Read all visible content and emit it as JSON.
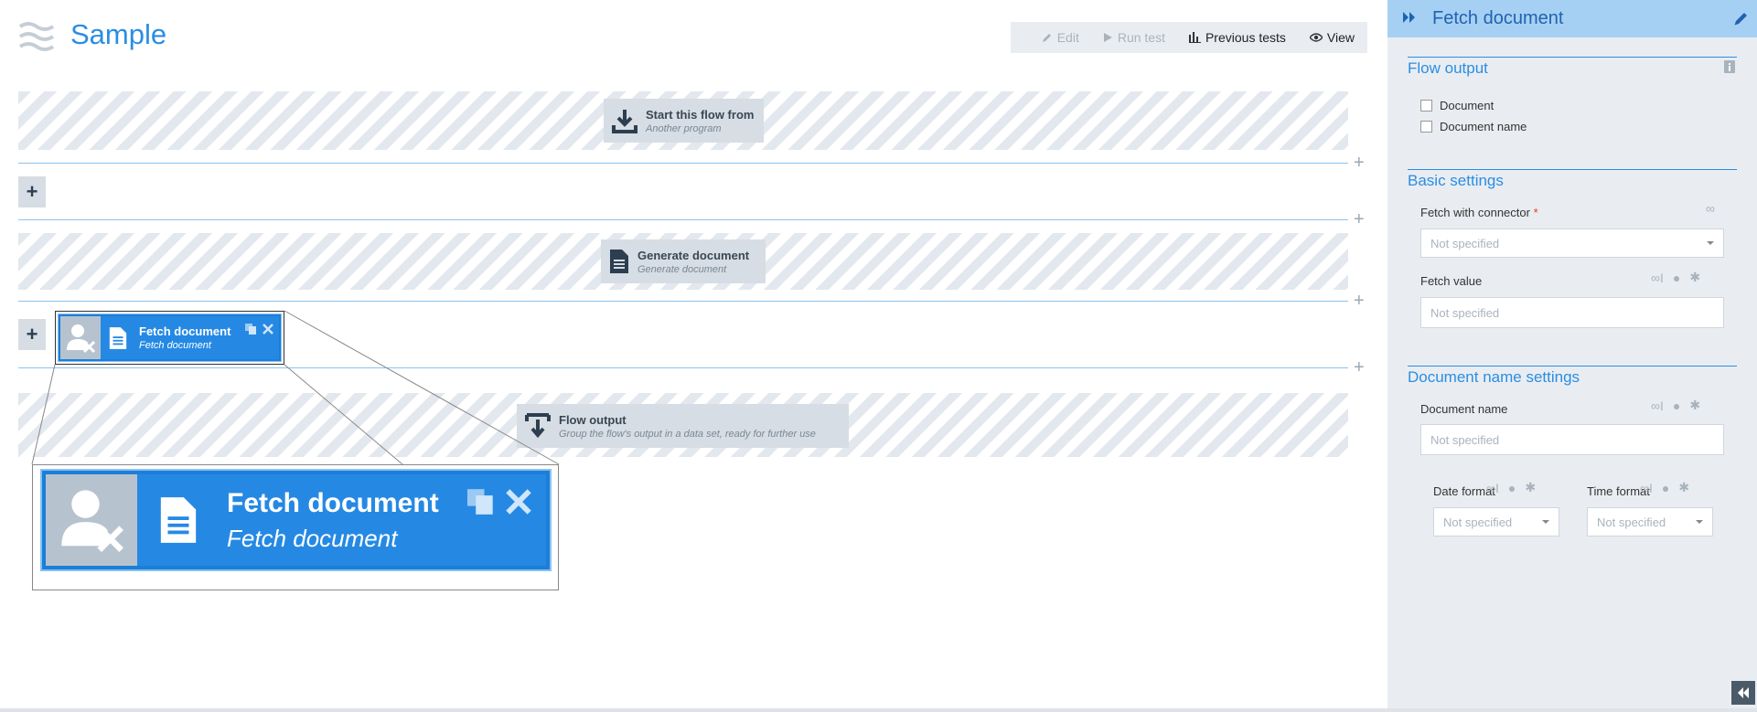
{
  "app": {
    "title": "Sample"
  },
  "toolbar": {
    "edit_label": "Edit",
    "run_test_label": "Run test",
    "previous_tests_label": "Previous tests",
    "view_label": "View"
  },
  "flow": {
    "start_node": {
      "title": "Start this flow from",
      "subtitle": "Another program"
    },
    "generate_node": {
      "title": "Generate document",
      "subtitle": "Generate document"
    },
    "fetch_node": {
      "title": "Fetch document",
      "subtitle": "Fetch document"
    },
    "output_node": {
      "title": "Flow output",
      "subtitle": "Group the flow's output in a data set, ready for further use"
    },
    "add_symbol": "+"
  },
  "panel": {
    "title": "Fetch document",
    "flow_output": {
      "title": "Flow output",
      "options": [
        "Document",
        "Document name"
      ]
    },
    "basic_settings": {
      "title": "Basic settings",
      "connector_label": "Fetch with connector",
      "required_marker": "*",
      "connector_value": "Not specified",
      "fetch_value_label": "Fetch value",
      "fetch_value_placeholder": "Not specified"
    },
    "document_name_settings": {
      "title": "Document name settings",
      "document_name_label": "Document name",
      "document_name_placeholder": "Not specified",
      "date_format_label": "Date format",
      "date_format_value": "Not specified",
      "time_format_label": "Time format",
      "time_format_value": "Not specified"
    }
  },
  "colors": {
    "accent": "#2b8de3",
    "node_selected": "#2589e4",
    "panel_bg": "#e9edf1",
    "panel_header": "#a6d0f3"
  }
}
